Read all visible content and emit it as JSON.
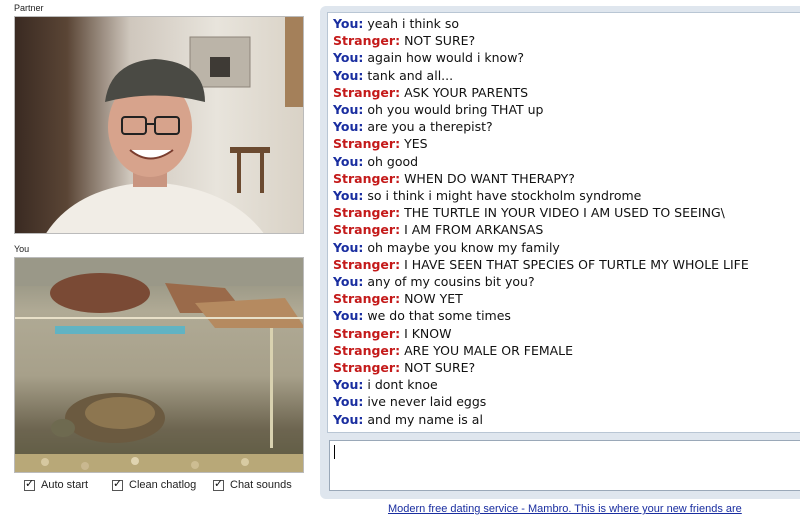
{
  "labels": {
    "partner": "Partner",
    "you": "You"
  },
  "options": [
    {
      "label": "Auto start",
      "checked": true
    },
    {
      "label": "Clean chatlog",
      "checked": true
    },
    {
      "label": "Chat sounds",
      "checked": true
    }
  ],
  "messages": [
    {
      "sender": "You:",
      "text": "yeah i think so"
    },
    {
      "sender": "Stranger:",
      "text": "NOT SURE?"
    },
    {
      "sender": "You:",
      "text": "again how would i know?"
    },
    {
      "sender": "You:",
      "text": "tank and all..."
    },
    {
      "sender": "Stranger:",
      "text": "ASK YOUR PARENTS"
    },
    {
      "sender": "You:",
      "text": "oh you would bring THAT up"
    },
    {
      "sender": "You:",
      "text": "are you a therepist?"
    },
    {
      "sender": "Stranger:",
      "text": "YES"
    },
    {
      "sender": "You:",
      "text": "oh good"
    },
    {
      "sender": "Stranger:",
      "text": "WHEN DO WANT THERAPY?"
    },
    {
      "sender": "You:",
      "text": "so i think i might have stockholm syndrome"
    },
    {
      "sender": "Stranger:",
      "text": "THE TURTLE IN YOUR VIDEO I AM USED TO SEEING\\"
    },
    {
      "sender": "Stranger:",
      "text": "I AM FROM ARKANSAS"
    },
    {
      "sender": "You:",
      "text": "oh maybe you know my family"
    },
    {
      "sender": "Stranger:",
      "text": "I HAVE SEEN THAT SPECIES OF TURTLE MY WHOLE LIFE"
    },
    {
      "sender": "You:",
      "text": "any of my cousins bit you?"
    },
    {
      "sender": "Stranger:",
      "text": "NOW YET"
    },
    {
      "sender": "You:",
      "text": "we do that some times"
    },
    {
      "sender": "Stranger:",
      "text": "I KNOW"
    },
    {
      "sender": "Stranger:",
      "text": "ARE YOU MALE OR FEMALE"
    },
    {
      "sender": "Stranger:",
      "text": "NOT SURE?"
    },
    {
      "sender": "You:",
      "text": "i dont knoe"
    },
    {
      "sender": "You:",
      "text": "ive never laid eggs"
    },
    {
      "sender": "You:",
      "text": "and my name is al"
    }
  ],
  "input": {
    "value": ""
  },
  "ad": {
    "text": "Modern free dating service - Mambro. This is where your new friends are"
  },
  "colors": {
    "you": "#1a2ea0",
    "stranger": "#c41a1a",
    "panel": "#dfe6ee"
  }
}
